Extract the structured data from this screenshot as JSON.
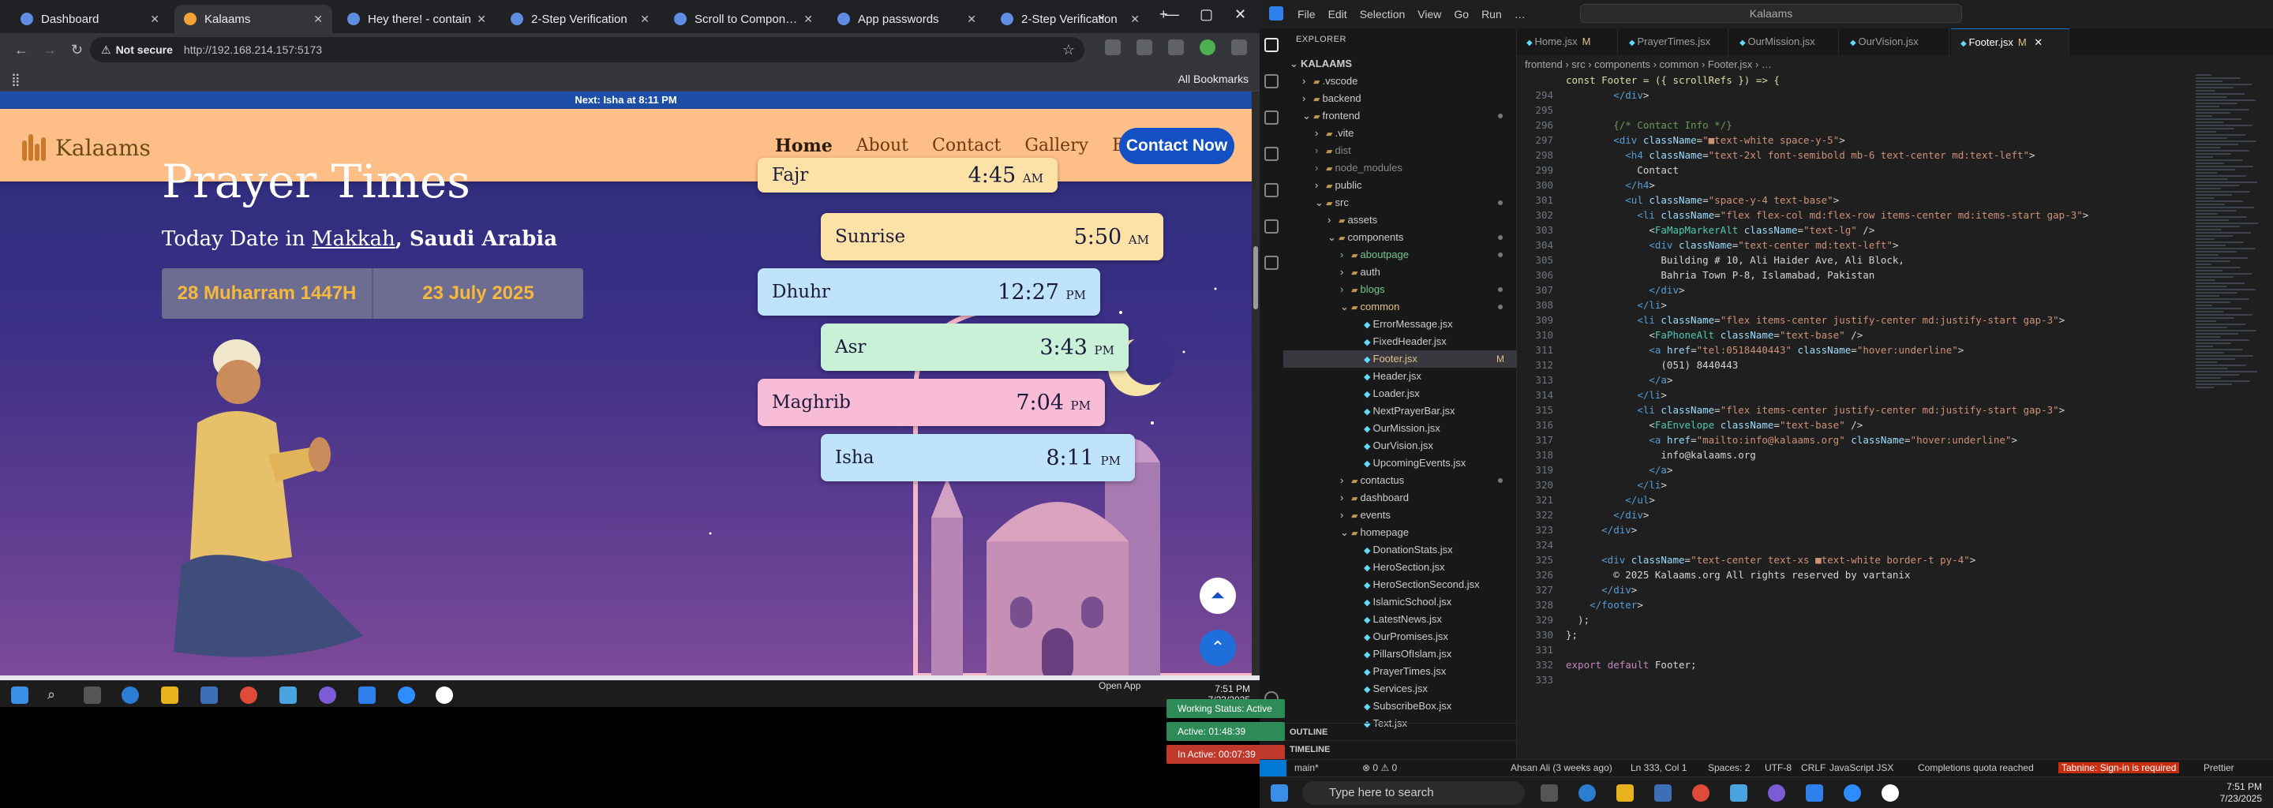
{
  "browser": {
    "tabs": [
      {
        "title": "Dashboard",
        "fav": "g"
      },
      {
        "title": "Kalaams",
        "fav": "k",
        "active": true
      },
      {
        "title": "Hey there! - contain",
        "fav": "g"
      },
      {
        "title": "2-Step Verification",
        "fav": "g"
      },
      {
        "title": "Scroll to Components",
        "fav": "g"
      },
      {
        "title": "App passwords",
        "fav": "g"
      },
      {
        "title": "2-Step Verification",
        "fav": "g"
      }
    ],
    "not_secure": "Not secure",
    "url": "http://192.168.214.157:5173",
    "all_bookmarks": "All Bookmarks"
  },
  "site": {
    "announcement": "Next: Isha at 8:11 PM",
    "logo_text": "Kalaams",
    "nav": [
      "Home",
      "About",
      "Contact",
      "Gallery",
      "Blogs"
    ],
    "cta": "Contact Now",
    "page_title": "Prayer Times",
    "today_prefix": "Today Date in ",
    "city": "Makkah",
    "country": ", Saudi Arabia",
    "hijri": "28 Muharram 1447H",
    "gregorian": "23 July 2025",
    "prayers": [
      {
        "name": "Fajr",
        "time": "4:45",
        "ampm": "AM",
        "color": "#fde2a8"
      },
      {
        "name": "Sunrise",
        "time": "5:50",
        "ampm": "AM",
        "color": "#fde2a8"
      },
      {
        "name": "Dhuhr",
        "time": "12:27",
        "ampm": "PM",
        "color": "#bfe3fb"
      },
      {
        "name": "Asr",
        "time": "3:43",
        "ampm": "PM",
        "color": "#c8f1d8"
      },
      {
        "name": "Maghrib",
        "time": "7:04",
        "ampm": "PM",
        "color": "#f9bcd6"
      },
      {
        "name": "Isha",
        "time": "8:11",
        "ampm": "PM",
        "color": "#bfe3fb"
      }
    ]
  },
  "taskbar_left": {
    "time": "7:51 PM",
    "date": "7/23/2025"
  },
  "vscode": {
    "menu": [
      "File",
      "Edit",
      "Selection",
      "View",
      "Go",
      "Run",
      "…"
    ],
    "search": "Kalaams",
    "explorer_title": "EXPLORER",
    "tree": [
      {
        "label": "KALAAMS",
        "d": 0,
        "type": "root"
      },
      {
        "label": ".vscode",
        "d": 1,
        "type": "dir"
      },
      {
        "label": "backend",
        "d": 1,
        "type": "dir"
      },
      {
        "label": "frontend",
        "d": 1,
        "type": "open",
        "flag": "dot"
      },
      {
        "label": ".vite",
        "d": 2,
        "type": "dir"
      },
      {
        "label": "dist",
        "d": 2,
        "type": "dir",
        "dim": true
      },
      {
        "label": "node_modules",
        "d": 2,
        "type": "dir",
        "dim": true
      },
      {
        "label": "public",
        "d": 2,
        "type": "dir"
      },
      {
        "label": "src",
        "d": 2,
        "type": "open",
        "flag": "dot"
      },
      {
        "label": "assets",
        "d": 3,
        "type": "dir"
      },
      {
        "label": "components",
        "d": 3,
        "type": "open",
        "flag": "dot"
      },
      {
        "label": "aboutpage",
        "d": 4,
        "type": "dir",
        "cls": "grn",
        "flag": "dot"
      },
      {
        "label": "auth",
        "d": 4,
        "type": "dir"
      },
      {
        "label": "blogs",
        "d": 4,
        "type": "dir",
        "cls": "grn",
        "flag": "dot"
      },
      {
        "label": "common",
        "d": 4,
        "type": "open",
        "cls": "mod",
        "flag": "dot"
      },
      {
        "label": "ErrorMessage.jsx",
        "d": 5,
        "type": "file"
      },
      {
        "label": "FixedHeader.jsx",
        "d": 5,
        "type": "file"
      },
      {
        "label": "Footer.jsx",
        "d": 5,
        "type": "file",
        "sel": true,
        "cls": "mod",
        "flag": "M"
      },
      {
        "label": "Header.jsx",
        "d": 5,
        "type": "file"
      },
      {
        "label": "Loader.jsx",
        "d": 5,
        "type": "file"
      },
      {
        "label": "NextPrayerBar.jsx",
        "d": 5,
        "type": "file"
      },
      {
        "label": "OurMission.jsx",
        "d": 5,
        "type": "file"
      },
      {
        "label": "OurVision.jsx",
        "d": 5,
        "type": "file"
      },
      {
        "label": "UpcomingEvents.jsx",
        "d": 5,
        "type": "file"
      },
      {
        "label": "contactus",
        "d": 4,
        "type": "dir",
        "flag": "dot"
      },
      {
        "label": "dashboard",
        "d": 4,
        "type": "dir"
      },
      {
        "label": "events",
        "d": 4,
        "type": "dir"
      },
      {
        "label": "homepage",
        "d": 4,
        "type": "open"
      },
      {
        "label": "DonationStats.jsx",
        "d": 5,
        "type": "file"
      },
      {
        "label": "HeroSection.jsx",
        "d": 5,
        "type": "file"
      },
      {
        "label": "HeroSectionSecond.jsx",
        "d": 5,
        "type": "file"
      },
      {
        "label": "IslamicSchool.jsx",
        "d": 5,
        "type": "file"
      },
      {
        "label": "LatestNews.jsx",
        "d": 5,
        "type": "file"
      },
      {
        "label": "OurPromises.jsx",
        "d": 5,
        "type": "file"
      },
      {
        "label": "PillarsOfIslam.jsx",
        "d": 5,
        "type": "file"
      },
      {
        "label": "PrayerTimes.jsx",
        "d": 5,
        "type": "file"
      },
      {
        "label": "Services.jsx",
        "d": 5,
        "type": "file"
      },
      {
        "label": "SubscribeBox.jsx",
        "d": 5,
        "type": "file"
      },
      {
        "label": "Text.jsx",
        "d": 5,
        "type": "file"
      }
    ],
    "outline": "OUTLINE",
    "timeline": "TIMELINE",
    "tabs": [
      {
        "label": "Home.jsx",
        "flag": "M"
      },
      {
        "label": "PrayerTimes.jsx",
        "flag": ""
      },
      {
        "label": "OurMission.jsx",
        "flag": ""
      },
      {
        "label": "OurVision.jsx",
        "flag": ""
      },
      {
        "label": "Footer.jsx",
        "flag": "M",
        "active": true
      }
    ],
    "breadcrumb": "frontend  ›  src  ›  components  ›  common  ›  Footer.jsx  ›  …",
    "sticky": "const Footer = ({ scrollRefs }) => {",
    "code": [
      {
        "n": "294",
        "t": "        </div>"
      },
      {
        "n": "295",
        "t": ""
      },
      {
        "n": "296",
        "t": "        {/* Contact Info */}"
      },
      {
        "n": "297",
        "t": "        <div className=\"■text-white space-y-5\">"
      },
      {
        "n": "298",
        "t": "          <h4 className=\"text-2xl font-semibold mb-6 text-center md:text-left\">"
      },
      {
        "n": "299",
        "t": "            Contact"
      },
      {
        "n": "300",
        "t": "          </h4>"
      },
      {
        "n": "301",
        "t": "          <ul className=\"space-y-4 text-base\">"
      },
      {
        "n": "302",
        "t": "            <li className=\"flex flex-col md:flex-row items-center md:items-start gap-3\">"
      },
      {
        "n": "303",
        "t": "              <FaMapMarkerAlt className=\"text-lg\" />"
      },
      {
        "n": "304",
        "t": "              <div className=\"text-center md:text-left\">"
      },
      {
        "n": "305",
        "t": "                Building # 10, Ali Haider Ave, Ali Block,"
      },
      {
        "n": "306",
        "t": "                Bahria Town P-8, Islamabad, Pakistan"
      },
      {
        "n": "307",
        "t": "              </div>"
      },
      {
        "n": "308",
        "t": "            </li>"
      },
      {
        "n": "309",
        "t": "            <li className=\"flex items-center justify-center md:justify-start gap-3\">"
      },
      {
        "n": "310",
        "t": "              <FaPhoneAlt className=\"text-base\" />"
      },
      {
        "n": "311",
        "t": "              <a href=\"tel:0518440443\" className=\"hover:underline\">"
      },
      {
        "n": "312",
        "t": "                (051) 8440443"
      },
      {
        "n": "313",
        "t": "              </a>"
      },
      {
        "n": "314",
        "t": "            </li>"
      },
      {
        "n": "315",
        "t": "            <li className=\"flex items-center justify-center md:justify-start gap-3\">"
      },
      {
        "n": "316",
        "t": "              <FaEnvelope className=\"text-base\" />"
      },
      {
        "n": "317",
        "t": "              <a href=\"mailto:info@kalaams.org\" className=\"hover:underline\">"
      },
      {
        "n": "318",
        "t": "                info@kalaams.org"
      },
      {
        "n": "319",
        "t": "              </a>"
      },
      {
        "n": "320",
        "t": "            </li>"
      },
      {
        "n": "321",
        "t": "          </ul>"
      },
      {
        "n": "322",
        "t": "        </div>"
      },
      {
        "n": "323",
        "t": "      </div>"
      },
      {
        "n": "324",
        "t": ""
      },
      {
        "n": "325",
        "t": "      <div className=\"text-center text-xs ■text-white border-t py-4\">"
      },
      {
        "n": "326",
        "t": "        © 2025 Kalaams.org All rights reserved by vartanix"
      },
      {
        "n": "327",
        "t": "      </div>"
      },
      {
        "n": "328",
        "t": "    </footer>"
      },
      {
        "n": "329",
        "t": "  );"
      },
      {
        "n": "330",
        "t": "};"
      },
      {
        "n": "331",
        "t": ""
      },
      {
        "n": "332",
        "t": "export default Footer;"
      },
      {
        "n": "333",
        "t": ""
      }
    ],
    "open_app": "Open App",
    "working_status": "Working Status: Active",
    "active_time": "Active: 01:48:39",
    "inactive_time": "In Active: 00:07:39",
    "status": {
      "branch": "main*",
      "problems": "⊗ 0 ⚠ 0",
      "blame": "Ahsan Ali (3 weeks ago)",
      "pos": "Ln 333, Col 1",
      "spaces": "Spaces: 2",
      "enc": "UTF-8",
      "eol": "CRLF",
      "lang": "JavaScript JSX",
      "quota": "Completions quota reached",
      "tabnine": "Tabnine: Sign-in is required",
      "prettier": "Prettier"
    }
  },
  "taskbar_right": {
    "search": "Type here to search",
    "time": "7:51 PM",
    "date": "7/23/2025"
  },
  "colors": {
    "accent": "#1250c4",
    "header_bg": "#fdbf87",
    "date_gold": "#f6b93b",
    "vscode_blue": "#0078d4"
  }
}
